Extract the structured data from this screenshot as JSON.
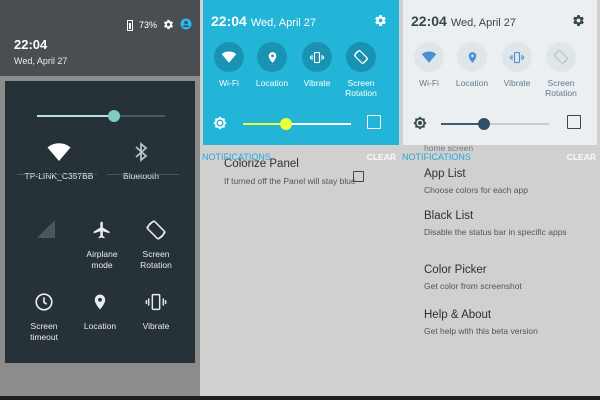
{
  "panel1": {
    "status": {
      "battery": "73%"
    },
    "time": "22:04",
    "date": "Wed, April 27",
    "brightness": 0.6,
    "wifi": {
      "label": "TP-LINK_C357BB",
      "icon": "wifi-icon"
    },
    "bluetooth": {
      "label": "Bluetooth",
      "icon": "bluetooth-icon"
    },
    "cellular": {
      "icon": "signal-icon"
    },
    "airplane": {
      "line1": "Airplane",
      "line2": "mode",
      "icon": "airplane-icon"
    },
    "rotation": {
      "line1": "Screen",
      "line2": "Rotation",
      "icon": "screen-rotation-icon"
    },
    "timeout": {
      "line1": "Screen",
      "line2": "timeout",
      "icon": "timer-icon"
    },
    "location": {
      "label": "Location",
      "icon": "location-icon"
    },
    "vibrate": {
      "label": "Vibrate",
      "icon": "vibrate-icon"
    }
  },
  "panel2": {
    "time": "22:04",
    "date": "Wed, April 27",
    "tiles": [
      {
        "label": "Wi-Fi"
      },
      {
        "label": "Location"
      },
      {
        "label": "Vibrate"
      },
      {
        "line1": "Screen",
        "line2": "Rotation"
      }
    ],
    "brightness": 0.4,
    "notifications_label": "NOTIFICATIONS",
    "clear_label": "CLEAR",
    "settings": [
      {
        "title": "Colorize Panel",
        "subtitle": "If turned off the Panel will stay blue"
      }
    ],
    "accent": "#22b5d7"
  },
  "panel3": {
    "time": "22:04",
    "date": "Wed, April 27",
    "tiles": [
      {
        "label": "Wi-Fi"
      },
      {
        "label": "Location"
      },
      {
        "label": "Vibrate"
      },
      {
        "line1": "Screen",
        "line2": "Rotation"
      }
    ],
    "brightness": 0.4,
    "notifications_label": "NOTIFICATIONS",
    "clear_label": "CLEAR",
    "peek_text": "home screen",
    "settings": [
      {
        "title": "App List",
        "subtitle": "Choose colors for each app"
      },
      {
        "title": "Black List",
        "subtitle": "Disable the status bar in specific apps"
      },
      {
        "title": "Color Picker",
        "subtitle": "Get color from screenshot"
      },
      {
        "title": "Help & About",
        "subtitle": "Get help with this beta version"
      }
    ],
    "accent": "#eceff1"
  }
}
